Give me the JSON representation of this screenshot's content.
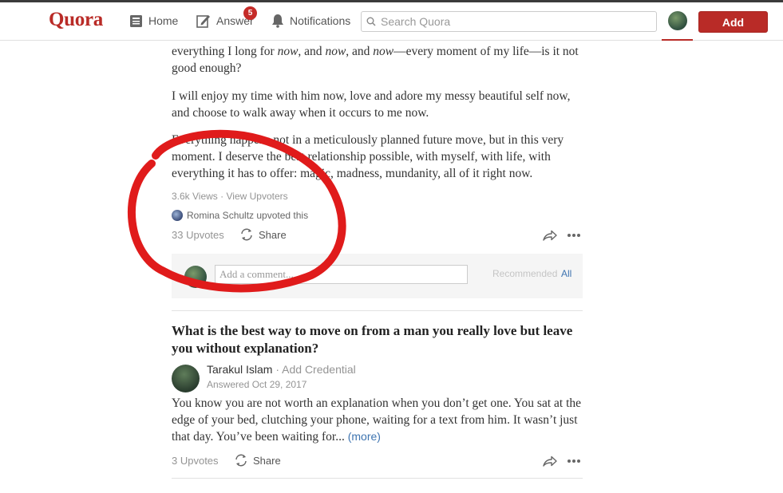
{
  "header": {
    "logo": "Quora",
    "nav": {
      "home": "Home",
      "answer": "Answer",
      "answer_badge": "5",
      "notifications": "Notifications"
    },
    "search_placeholder": "Search Quora",
    "add_button": "Add"
  },
  "answer1": {
    "para1_a": "everything I long for ",
    "para1_now1": "now",
    "para1_b": ", and ",
    "para1_now2": "now",
    "para1_c": ", and ",
    "para1_now3": "now",
    "para1_d": "—every moment of my life—is it not good enough?",
    "para2": "I will enjoy my time with him now, love and adore my messy beautiful self now, and choose to walk away when it occurs to me now.",
    "para3": "Everything happens not in a meticulously planned future move, but in this very moment. I deserve the best relationship possible, with myself, with life, with everything it has to offer: magic, madness, mundanity, all of it right now.",
    "views": "3.6k Views",
    "view_upvoters": "View Upvoters",
    "upvoted_by": "Romina Schultz upvoted this",
    "upvotes": "33 Upvotes",
    "share": "Share",
    "comment_placeholder": "Add a comment...",
    "recommended": "Recommended",
    "all": "All"
  },
  "answer2": {
    "question": "What is the best way to move on from a man you really love but leave you without explanation?",
    "author": "Tarakul Islam",
    "credential": "Add Credential",
    "answered": "Answered Oct 29, 2017",
    "text": "You know you are not worth an explanation when you don’t get one. You sat at the edge of your bed, clutching your phone, waiting for a text from him. It wasn’t just that day. You’ve been waiting for...",
    "more": "(more)",
    "upvotes": "3 Upvotes",
    "share": "Share"
  },
  "colors": {
    "brand": "#b92b27",
    "link": "#3e74b0",
    "annotation": "#e01b1b"
  }
}
